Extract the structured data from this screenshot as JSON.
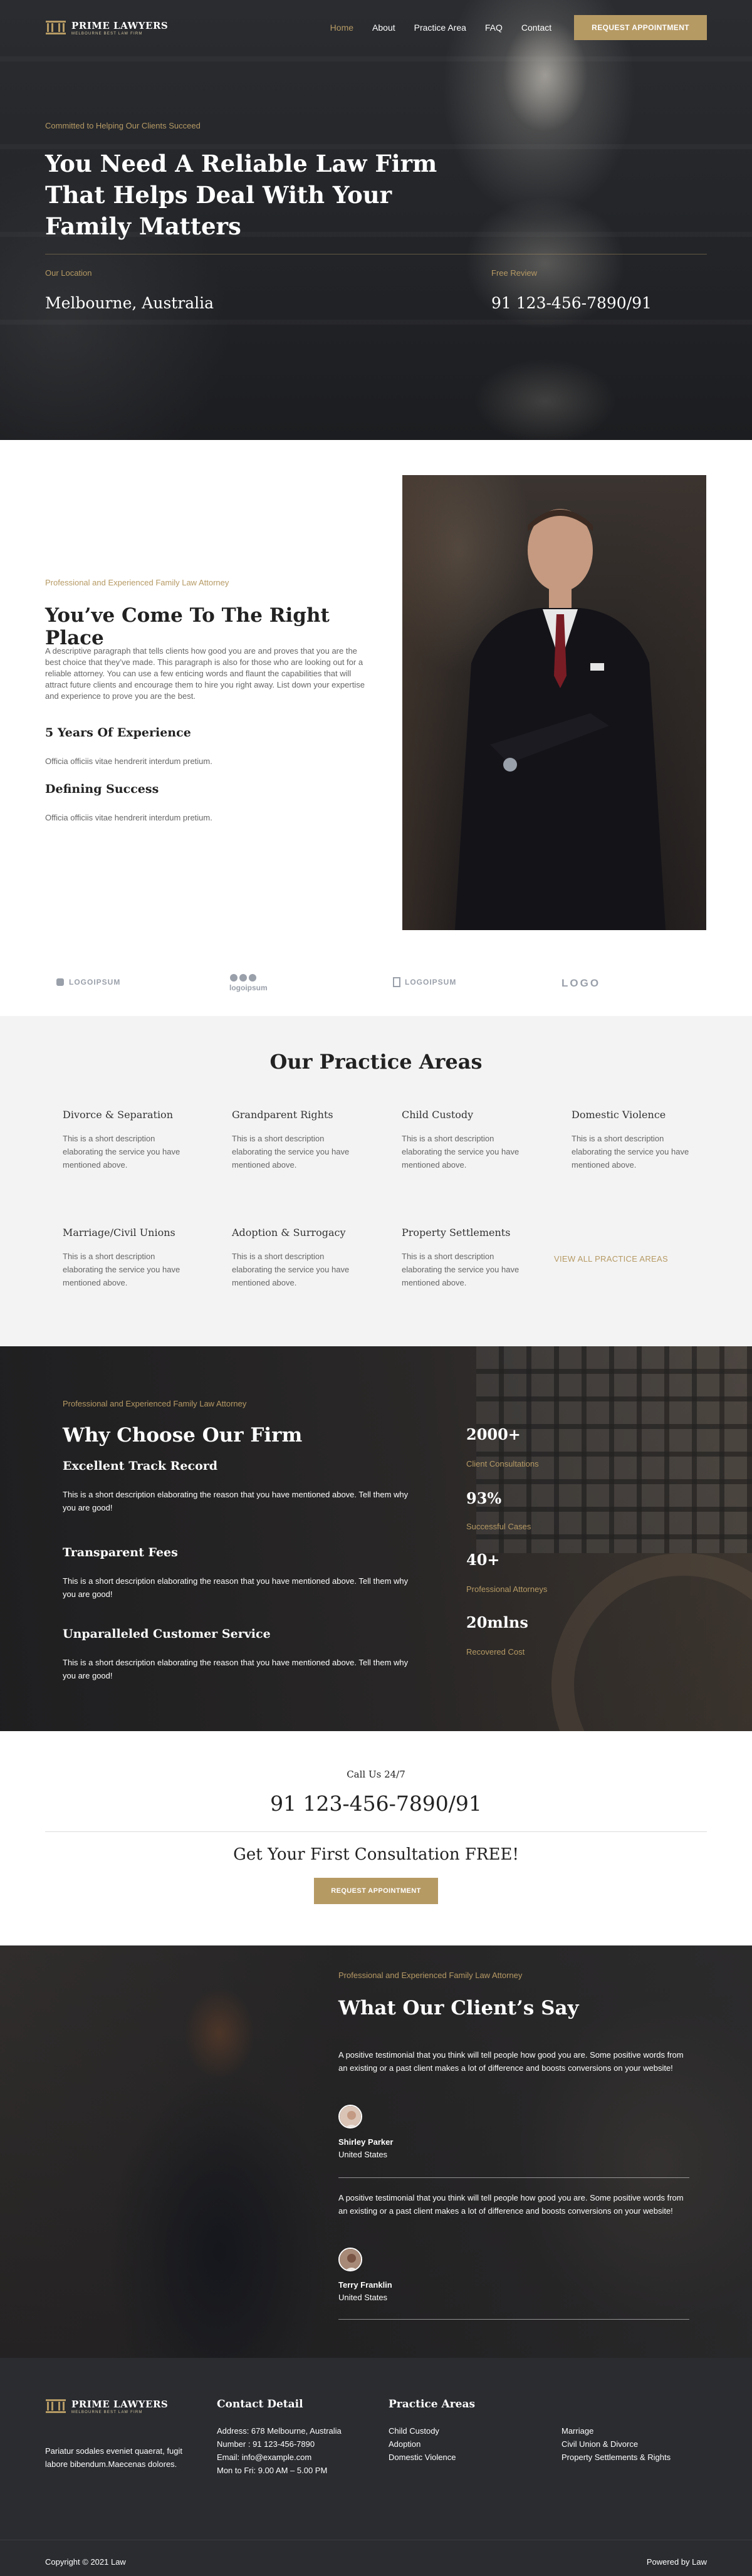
{
  "brand": {
    "name": "PRIME LAWYERS",
    "tagline": "MELBOURNE BEST LAW FIRM",
    "accent": "#b69a64",
    "dark": "#2a2c30"
  },
  "nav": {
    "items": [
      {
        "label": "Home",
        "active": true
      },
      {
        "label": "About",
        "active": false
      },
      {
        "label": "Practice Area",
        "active": false
      },
      {
        "label": "FAQ",
        "active": false
      },
      {
        "label": "Contact",
        "active": false
      }
    ],
    "cta": "REQUEST APPOINTMENT"
  },
  "hero": {
    "tagline": "Committed to Helping Our Clients Succeed",
    "title": "You Need A Reliable Law Firm That Helps Deal With Your Family Matters",
    "location_label": "Our Location",
    "location_value": "Melbourne, Australia",
    "review_label": "Free Review",
    "review_value": "91 123-456-7890/91"
  },
  "about": {
    "kicker": "Professional and Experienced Family Law Attorney",
    "title": "You’ve Come To The Right Place",
    "paragraph": "A descriptive paragraph that tells clients how good you are and proves that you are the best choice that they’ve made. This paragraph is also for those who are looking out for a reliable attorney. You can use a few enticing words and flaunt the capabilities that will attract future clients and encourage them to hire you right away. List down your expertise and experience to prove you are the best.",
    "points": [
      {
        "title": "5 Years Of Experience",
        "text": "Officia officiis vitae hendrerit interdum pretium."
      },
      {
        "title": "Defining Success",
        "text": "Officia officiis vitae hendrerit interdum pretium."
      }
    ]
  },
  "logos": [
    "LOGOIPSUM",
    "logoipsum",
    "LOGOIPSUM",
    "LOGO"
  ],
  "practice": {
    "title": "Our Practice Areas",
    "areas": [
      {
        "title": "Divorce & Separation",
        "desc": "This is a short description elaborating the service you have mentioned above."
      },
      {
        "title": "Grandparent Rights",
        "desc": "This is a short description elaborating the service you have mentioned above."
      },
      {
        "title": "Child Custody",
        "desc": "This is a short description elaborating the service you have mentioned above."
      },
      {
        "title": "Domestic Violence",
        "desc": "This is a short description elaborating the service you have mentioned above."
      },
      {
        "title": "Marriage/Civil Unions",
        "desc": "This is a short description elaborating the service you have mentioned above."
      },
      {
        "title": "Adoption & Surrogacy",
        "desc": "This is a short description elaborating the service you have mentioned above."
      },
      {
        "title": "Property Settlements",
        "desc": "This is a short description elaborating the service you have mentioned above."
      }
    ],
    "view_all": "VIEW ALL PRACTICE AREAS"
  },
  "why": {
    "kicker": "Professional and Experienced Family Law Attorney",
    "title": "Why Choose Our Firm",
    "reasons": [
      {
        "title": "Excellent Track Record",
        "text": "This is a short description elaborating the reason that you have mentioned above. Tell them why you are good!"
      },
      {
        "title": "Transparent Fees",
        "text": "This is a short description elaborating the reason that you have mentioned above. Tell them why you are good!"
      },
      {
        "title": "Unparalleled Customer Service",
        "text": "This is a short description elaborating the reason that you have mentioned above. Tell them why you are good!"
      }
    ],
    "stats": [
      {
        "value": "2000+",
        "label": "Client Consultations"
      },
      {
        "value": "93%",
        "label": "Successful Cases"
      },
      {
        "value": "40+",
        "label": "Professional Attorneys"
      },
      {
        "value": "20mlns",
        "label": "Recovered Cost"
      }
    ]
  },
  "call": {
    "label": "Call Us 24/7",
    "number": "91 123-456-7890/91",
    "offer": "Get Your First Consultation FREE!",
    "cta": "REQUEST APPOINTMENT"
  },
  "testimonials": {
    "kicker": "Professional and Experienced Family Law Attorney",
    "title": "What Our Client’s Say",
    "items": [
      {
        "quote": "A positive testimonial that you think will tell people how good you are. Some positive words from an existing or a past client makes a lot of difference and boosts conversions on your website!",
        "name": "Shirley Parker",
        "location": "United States"
      },
      {
        "quote": "A positive testimonial that you think will tell people how good you are. Some positive words from an existing or a past client makes a lot of difference and boosts conversions on your website!",
        "name": "Terry Franklin",
        "location": "United States"
      }
    ]
  },
  "footer": {
    "about": "Pariatur sodales eveniet quaerat, fugit labore bibendum.Maecenas dolores.",
    "contact_title": "Contact Detail",
    "contact": [
      "Address: 678 Melbourne, Australia",
      "Number : 91 123-456-7890",
      "Email: info@example.com",
      "Mon to Fri: 9.00 AM – 5.00 PM"
    ],
    "areas_title": "Practice Areas",
    "areas_col1": [
      "Child Custody",
      "Adoption",
      "Domestic Violence"
    ],
    "areas_col2": [
      "Marriage",
      "Civil Union & Divorce",
      "Property Settlements & Rights"
    ],
    "copyright": "Copyright © 2021 Law",
    "powered": "Powered by Law"
  }
}
